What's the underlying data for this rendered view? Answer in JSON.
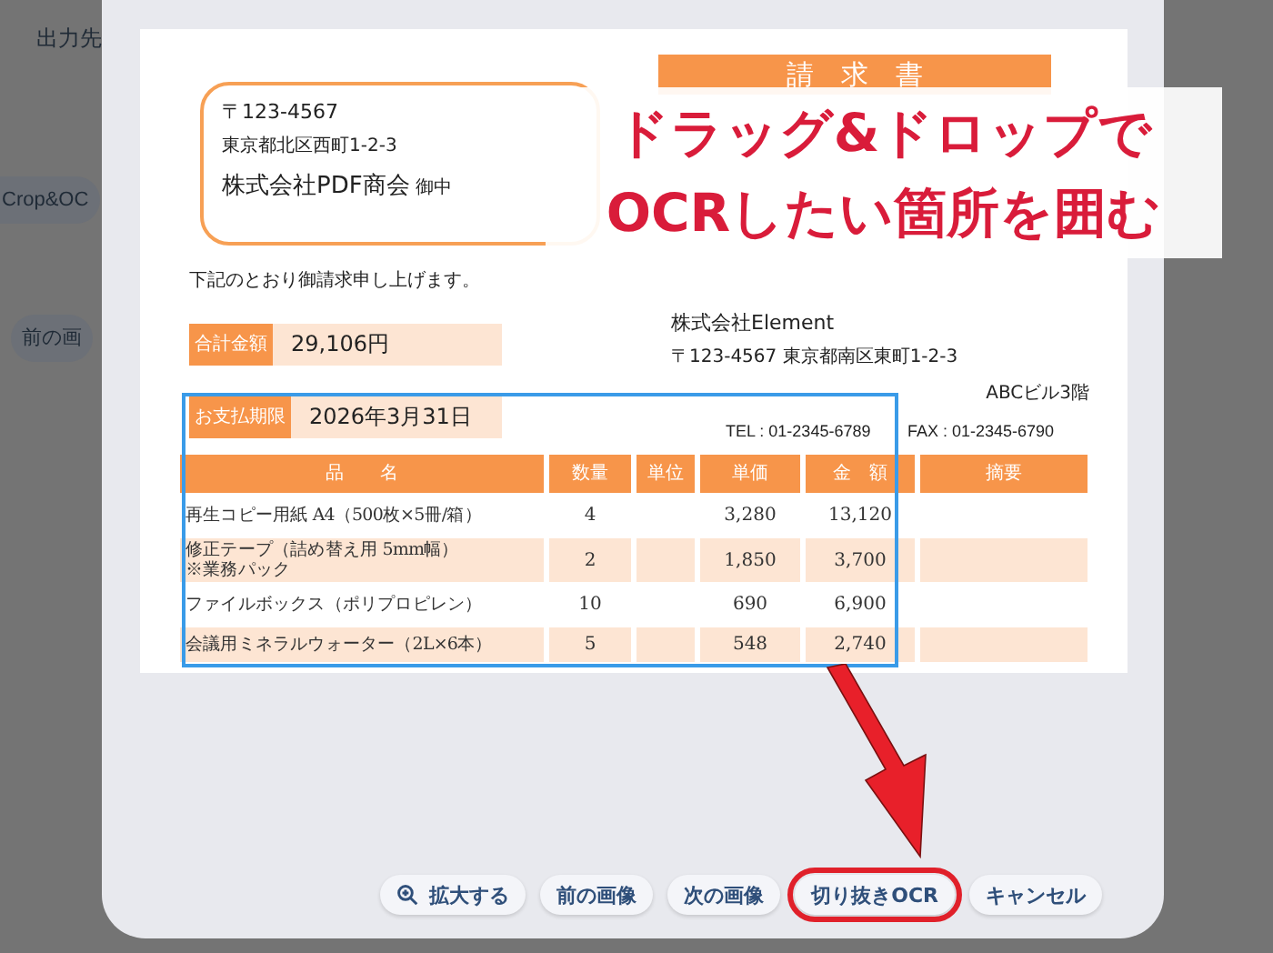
{
  "background_app": {
    "toolbar_label": "出力先",
    "crop_chip": "Crop&OC",
    "prev_chip": "前の画"
  },
  "dialog": {
    "document": {
      "recipient": {
        "postal": "〒123-4567",
        "address": "東京都北区西町1-2-3",
        "company": "株式会社PDF商会",
        "honorific": "御中"
      },
      "title": "請　求　書",
      "greeting": "下記のとおり御請求申し上げます。",
      "total": {
        "label": "合計金額",
        "value": "29,106円"
      },
      "due": {
        "label": "お支払期限",
        "value": "2026年3月31日"
      },
      "issuer": {
        "company": "株式会社Element",
        "address": "〒123-4567 東京都南区東町1-2-3",
        "building": "ABCビル3階",
        "tel": "TEL : 01-2345-6789",
        "fax": "FAX : 01-2345-6790"
      },
      "table": {
        "columns": [
          "品　　名",
          "数量",
          "単位",
          "単価",
          "金　額",
          "摘要"
        ],
        "rows": [
          {
            "cells": [
              "再生コピー用紙 A4（500枚×5冊/箱）",
              "4",
              "",
              "3,280",
              "13,120",
              ""
            ]
          },
          {
            "cells": [
              "修正テープ（詰め替え用 5mm幅）\n※業務パック",
              "2",
              "",
              "1,850",
              "3,700",
              ""
            ]
          },
          {
            "cells": [
              "ファイルボックス（ポリプロピレン）",
              "10",
              "",
              "690",
              "6,900",
              ""
            ]
          },
          {
            "cells": [
              "会議用ミネラルウォーター（2L×6本）",
              "5",
              "",
              "548",
              "2,740",
              ""
            ]
          }
        ]
      }
    },
    "callout": [
      "ドラッグ&ドロップで",
      "OCRしたい箇所を囲む"
    ],
    "buttons": [
      {
        "label": "拡大する",
        "kind": "zoom",
        "highlighted": false
      },
      {
        "label": "前の画像",
        "kind": "plain",
        "highlighted": false
      },
      {
        "label": "次の画像",
        "kind": "plain",
        "highlighted": false
      },
      {
        "label": "切り抜きOCR",
        "kind": "plain",
        "highlighted": true
      },
      {
        "label": "キャンセル",
        "kind": "plain",
        "highlighted": false
      }
    ]
  }
}
